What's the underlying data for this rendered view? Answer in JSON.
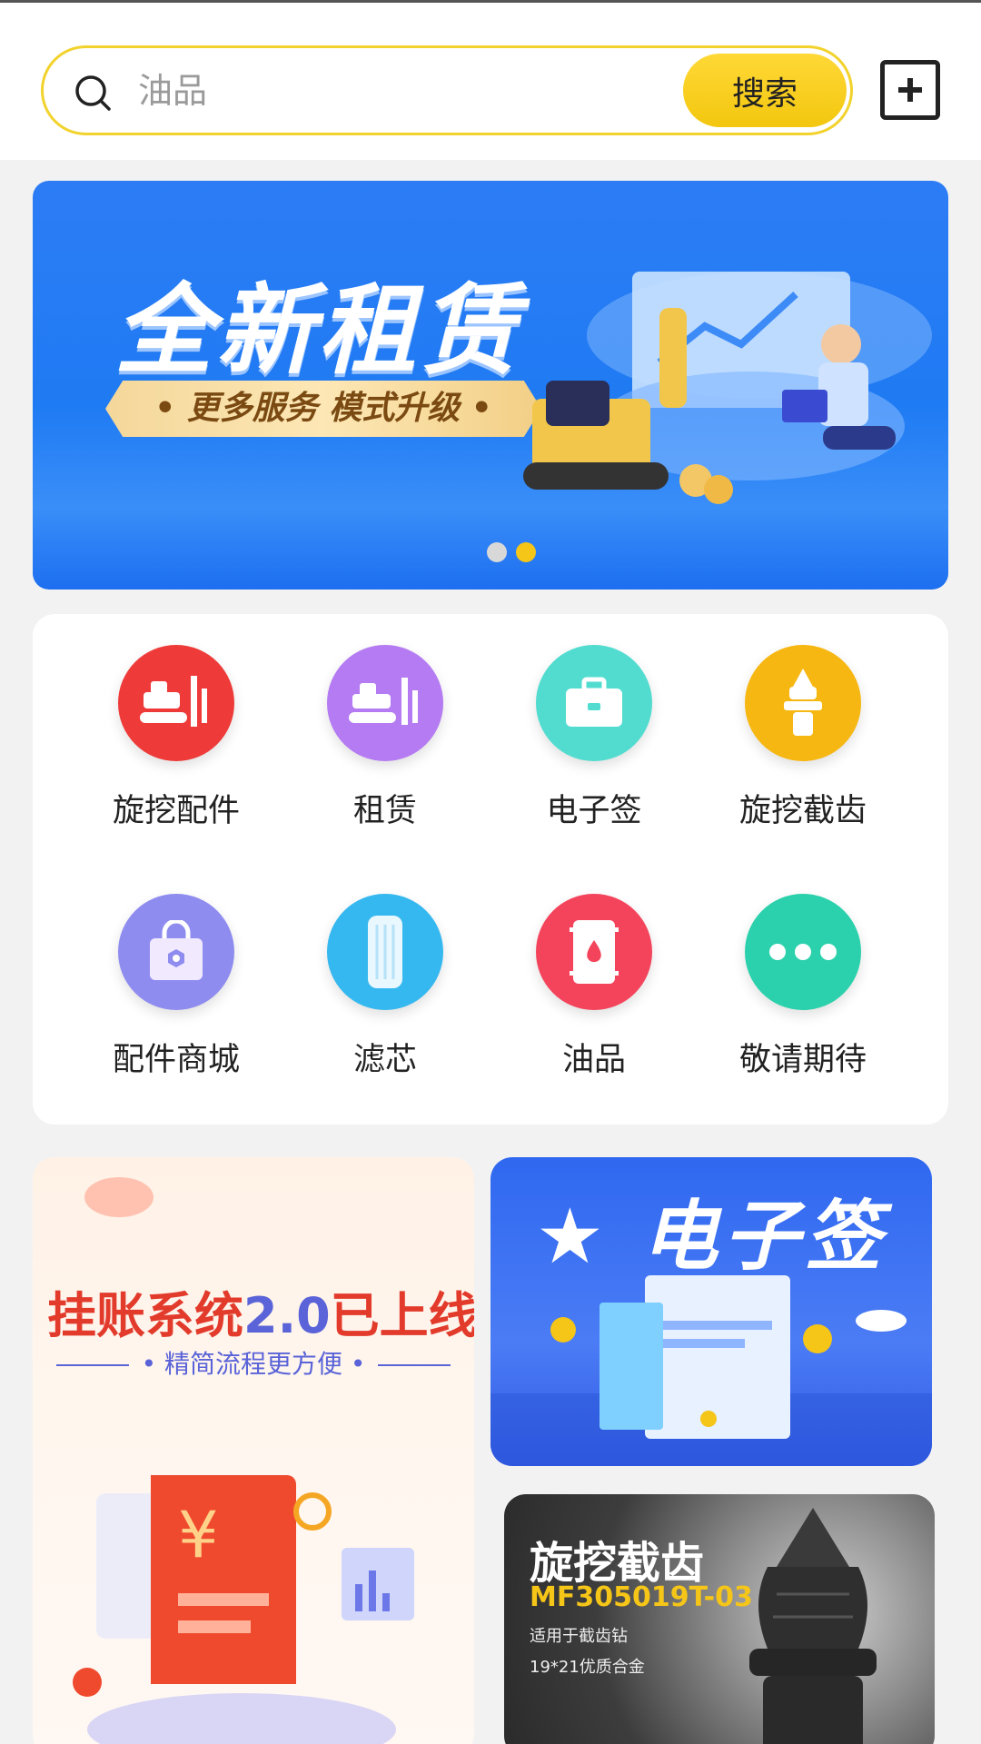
{
  "search": {
    "placeholder": "油品",
    "button_label": "搜索"
  },
  "banner": {
    "title": "全新租赁",
    "subtitle": "• 更多服务 模式升级 •",
    "slide_count": 2,
    "active_slide": 2
  },
  "categories": [
    {
      "label": "旋挖配件",
      "icon": "drill-rig-icon",
      "color": "#ee3b39"
    },
    {
      "label": "租赁",
      "icon": "excavator-icon",
      "color": "#b57bf2"
    },
    {
      "label": "电子签",
      "icon": "briefcase-icon",
      "color": "#52dcd0"
    },
    {
      "label": "旋挖截齿",
      "icon": "cutting-tooth-icon",
      "color": "#f7b712"
    },
    {
      "label": "配件商城",
      "icon": "shopping-bag-icon",
      "color": "#8f8cf0"
    },
    {
      "label": "滤芯",
      "icon": "filter-cartridge-icon",
      "color": "#35b8ef"
    },
    {
      "label": "油品",
      "icon": "oil-barrel-icon",
      "color": "#f4445c"
    },
    {
      "label": "敬请期待",
      "icon": "more-icon",
      "color": "#2bd1ac"
    }
  ],
  "promos": {
    "credit": {
      "title_a": "挂账系统",
      "title_ver": "2.0",
      "title_b": "已上线",
      "subtitle": "• 精简流程更方便 •"
    },
    "esign": {
      "title": "★ 电子签 ★"
    },
    "tooth": {
      "title": "旋挖截齿",
      "model": "MF305019T-03",
      "line1": "适用于截齿钻",
      "line2": "19*21优质合金"
    }
  }
}
